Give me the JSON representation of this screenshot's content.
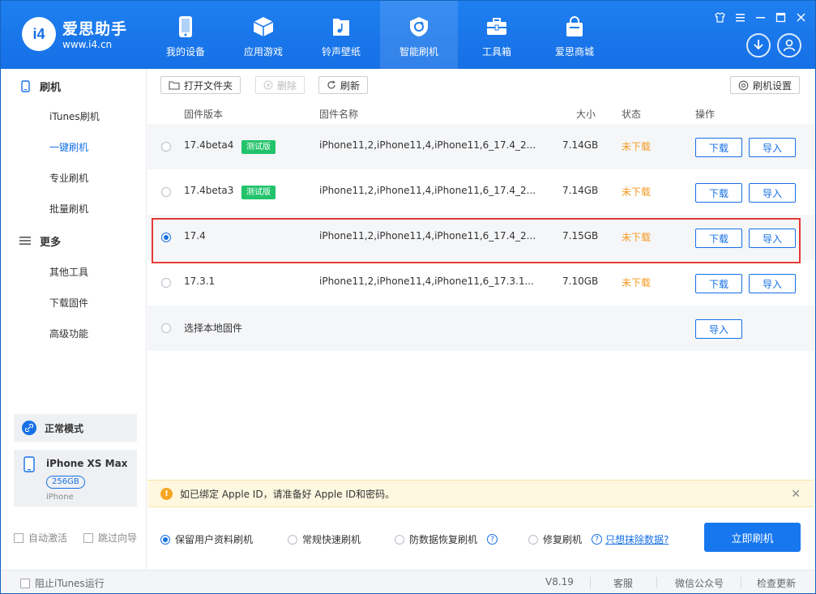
{
  "brand": {
    "name": "爱思助手",
    "url": "www.i4.cn",
    "logo_text": "i4"
  },
  "nav": [
    {
      "label": "我的设备",
      "icon": "phone-icon"
    },
    {
      "label": "应用游戏",
      "icon": "cube-icon"
    },
    {
      "label": "铃声壁纸",
      "icon": "music-file-icon"
    },
    {
      "label": "智能刷机",
      "icon": "refresh-shield-icon",
      "active": true
    },
    {
      "label": "工具箱",
      "icon": "toolbox-icon"
    },
    {
      "label": "爱思商城",
      "icon": "shopping-bag-icon"
    }
  ],
  "sidebar": {
    "group1": "刷机",
    "items1": [
      "iTunes刷机",
      "一键刷机",
      "专业刷机",
      "批量刷机"
    ],
    "group2": "更多",
    "items2": [
      "其他工具",
      "下载固件",
      "高级功能"
    ],
    "mode": "正常模式",
    "device": {
      "name": "iPhone XS Max",
      "capacity": "256GB",
      "type": "iPhone"
    },
    "auto_activate": "自动激活",
    "skip_guide": "跳过向导"
  },
  "toolbar": {
    "open_folder": "打开文件夹",
    "delete": "删除",
    "refresh": "刷新",
    "settings": "刷机设置"
  },
  "table": {
    "headers": {
      "version": "固件版本",
      "name": "固件名称",
      "size": "大小",
      "status": "状态",
      "action": "操作"
    },
    "rows": [
      {
        "version": "17.4beta4",
        "badge": "测试版",
        "name": "iPhone11,2,iPhone11,4,iPhone11,6_17.4_2...",
        "size": "7.14GB",
        "status": "未下载",
        "download": "下载",
        "import": "导入"
      },
      {
        "version": "17.4beta3",
        "badge": "测试版",
        "name": "iPhone11,2,iPhone11,4,iPhone11,6_17.4_2...",
        "size": "7.14GB",
        "status": "未下载",
        "download": "下载",
        "import": "导入"
      },
      {
        "version": "17.4",
        "name": "iPhone11,2,iPhone11,4,iPhone11,6_17.4_2...",
        "size": "7.15GB",
        "status": "未下载",
        "download": "下载",
        "import": "导入",
        "selected": true
      },
      {
        "version": "17.3.1",
        "name": "iPhone11,2,iPhone11,4,iPhone11,6_17.3.1...",
        "size": "7.10GB",
        "status": "未下载",
        "download": "下载",
        "import": "导入"
      }
    ],
    "local": {
      "label": "选择本地固件",
      "import": "导入"
    }
  },
  "notice": {
    "text": "如已绑定 Apple ID，请准备好 Apple ID和密码。"
  },
  "options": {
    "keep_data": "保留用户资料刷机",
    "quick": "常规快速刷机",
    "anti_recovery": "防数据恢复刷机",
    "repair": "修复刷机",
    "erase_link": "只想抹除数据?",
    "primary": "立即刷机"
  },
  "statusbar": {
    "block_itunes": "阻止iTunes运行",
    "version": "V8.19",
    "support": "客服",
    "wechat": "微信公众号",
    "update": "检查更新"
  }
}
